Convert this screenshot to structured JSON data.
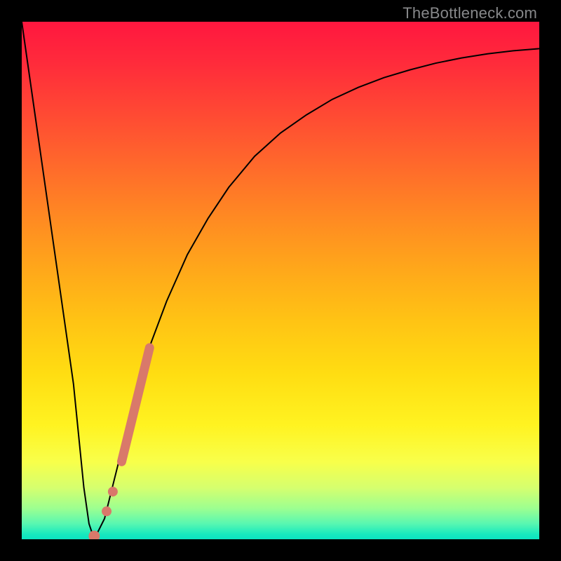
{
  "watermark": "TheBottleneck.com",
  "colors": {
    "frame": "#000000",
    "curve": "#000000",
    "marker": "#d9796a",
    "watermark": "#87888a"
  },
  "chart_data": {
    "type": "line",
    "title": "",
    "xlabel": "",
    "ylabel": "",
    "xlim": [
      0,
      100
    ],
    "ylim": [
      0,
      100
    ],
    "series": [
      {
        "name": "bottleneck-curve",
        "x": [
          0,
          2,
          4,
          6,
          8,
          10,
          11,
          12,
          13,
          14,
          16,
          18,
          20,
          22,
          25,
          28,
          32,
          36,
          40,
          45,
          50,
          55,
          60,
          65,
          70,
          75,
          80,
          85,
          90,
          95,
          100
        ],
        "values": [
          100,
          86,
          72,
          58,
          44,
          30,
          20,
          10,
          3,
          0,
          4,
          12,
          20,
          28,
          38,
          46,
          55,
          62,
          68,
          74,
          78.5,
          82,
          85,
          87.3,
          89.2,
          90.7,
          92,
          93,
          93.8,
          94.4,
          94.8
        ]
      }
    ],
    "markers": [
      {
        "name": "trail-upper",
        "shape": "line",
        "x0": 19.3,
        "y0": 15,
        "x1": 24.7,
        "y1": 37,
        "width": 13
      },
      {
        "name": "trail-dot-1",
        "shape": "circle",
        "cx": 17.6,
        "cy": 9.2,
        "r": 7
      },
      {
        "name": "trail-dot-2",
        "shape": "circle",
        "cx": 16.4,
        "cy": 5.4,
        "r": 7
      },
      {
        "name": "trail-base",
        "shape": "circle",
        "cx": 14.0,
        "cy": 0.6,
        "r": 8
      }
    ],
    "annotations": []
  }
}
